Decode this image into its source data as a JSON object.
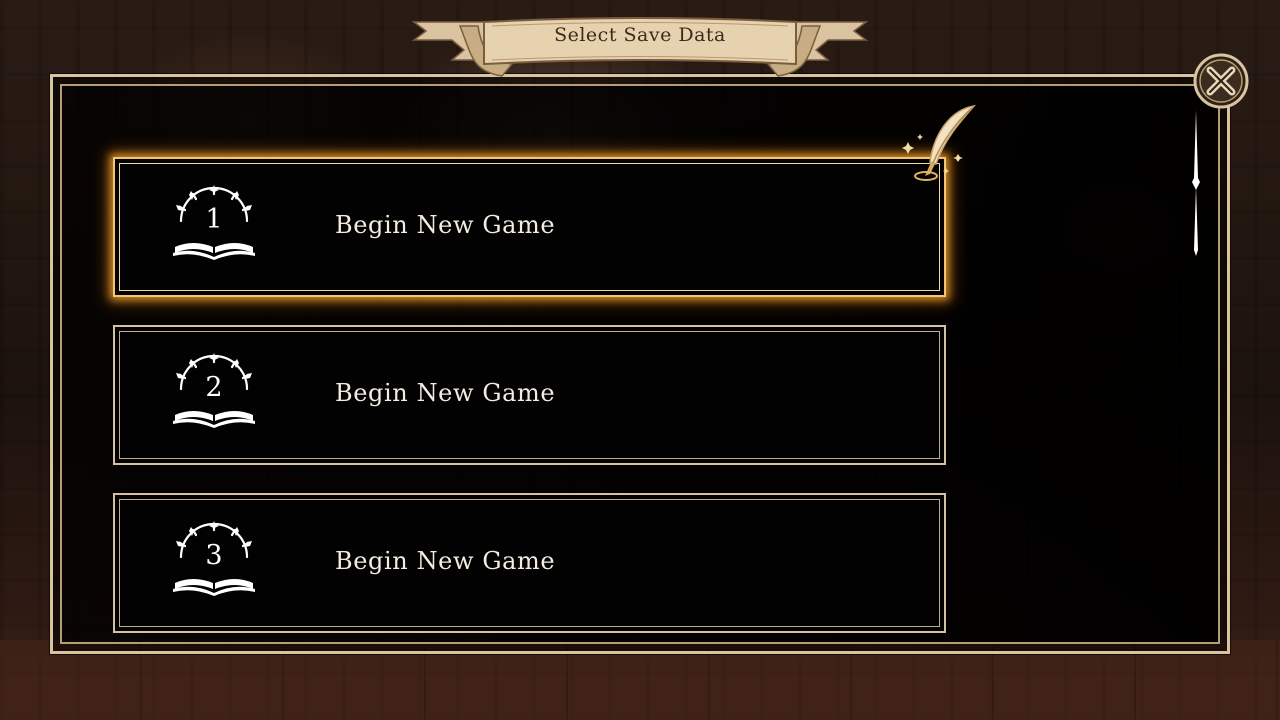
{
  "screen": {
    "title": "Select Save Data"
  },
  "slots": [
    {
      "number": "1",
      "label": "Begin New Game",
      "selected": true
    },
    {
      "number": "2",
      "label": "Begin New Game",
      "selected": false
    },
    {
      "number": "3",
      "label": "Begin New Game",
      "selected": false
    }
  ],
  "icons": {
    "close": "close-icon",
    "slot": "open-book-sunburst-icon",
    "cursor": "quill-icon",
    "scroll": "scroll-indicator"
  },
  "colors": {
    "frame": "#d9c3a0",
    "highlight": "#f0c67a",
    "banner": "#e6d2ae",
    "text": "#f4ece0"
  }
}
